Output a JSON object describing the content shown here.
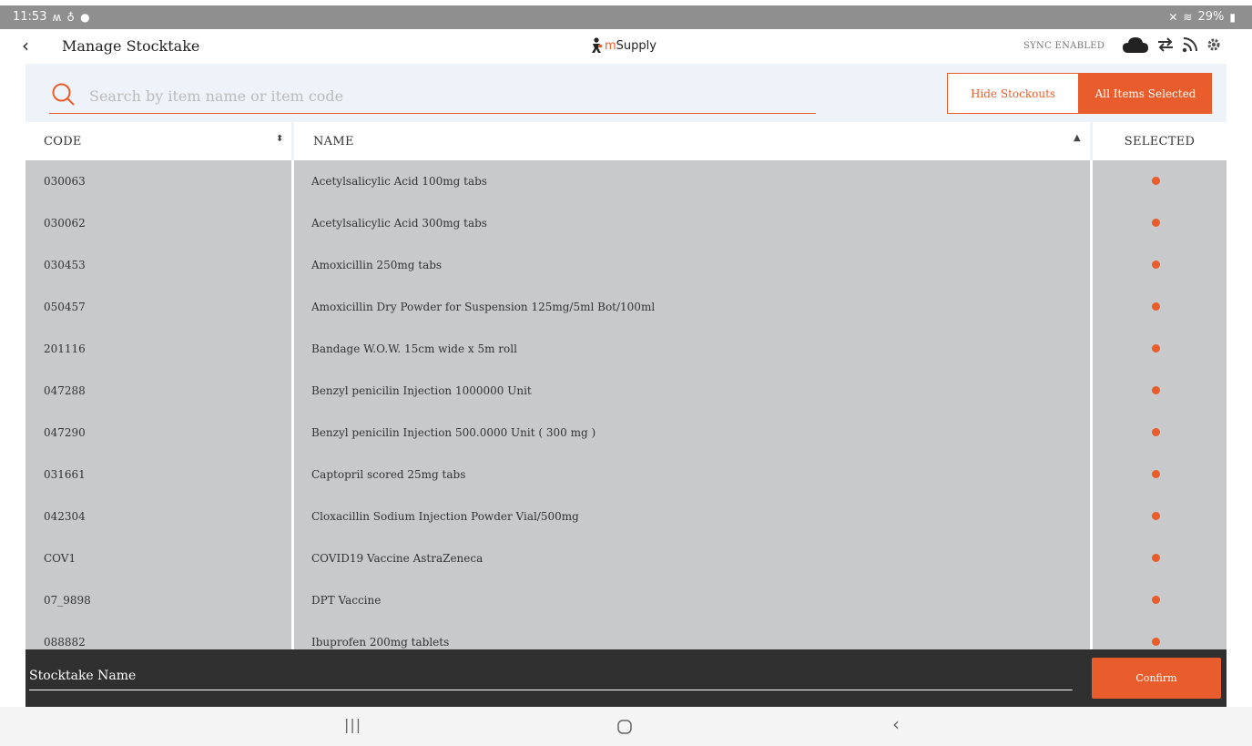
{
  "status_bar": {
    "time": "11:53",
    "battery": "29%"
  },
  "header": {
    "title": "Manage Stocktake",
    "logo_text": "Supply",
    "logo_m": "m",
    "sync_status": "SYNC ENABLED"
  },
  "search": {
    "placeholder": "Search by item name or item code",
    "value": ""
  },
  "filters": {
    "hide_stockouts": "Hide Stockouts",
    "all_items_selected": "All Items Selected"
  },
  "table": {
    "columns": {
      "code": "CODE",
      "name": "NAME",
      "selected": "SELECTED"
    },
    "rows": [
      {
        "code": "030063",
        "name": "Acetylsalicylic Acid 100mg tabs"
      },
      {
        "code": "030062",
        "name": "Acetylsalicylic Acid 300mg tabs"
      },
      {
        "code": "030453",
        "name": "Amoxicillin 250mg tabs"
      },
      {
        "code": "050457",
        "name": "Amoxicillin Dry Powder for Suspension 125mg/5ml Bot/100ml"
      },
      {
        "code": "201116",
        "name": "Bandage W.O.W. 15cm wide x 5m roll"
      },
      {
        "code": "047288",
        "name": "Benzyl penicilin Injection 1000000 Unit"
      },
      {
        "code": "047290",
        "name": "Benzyl penicilin Injection 500.0000 Unit ( 300 mg )"
      },
      {
        "code": "031661",
        "name": "Captopril scored 25mg tabs"
      },
      {
        "code": "042304",
        "name": "Cloxacillin Sodium Injection Powder Vial/500mg"
      },
      {
        "code": "COV1",
        "name": "COVID19 Vaccine AstraZeneca"
      },
      {
        "code": "07_9898",
        "name": "DPT Vaccine"
      },
      {
        "code": "088882",
        "name": "Ibuprofen 200mg tablets"
      }
    ]
  },
  "footer": {
    "stocktake_name_placeholder": "Stocktake Name",
    "confirm_label": "Confirm"
  },
  "colors": {
    "accent": "#e95c2b",
    "row_bg": "#c7c9ca",
    "footer_bg": "#303030"
  }
}
